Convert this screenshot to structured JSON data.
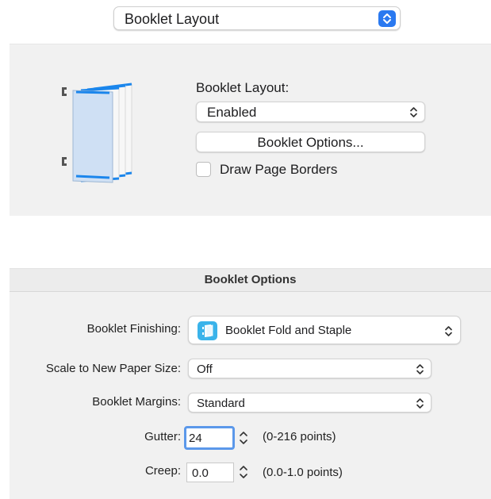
{
  "top_popup": {
    "label": "Booklet Layout"
  },
  "layout_section": {
    "label": "Booklet Layout:",
    "mode_value": "Enabled",
    "options_button": "Booklet Options...",
    "draw_borders_label": "Draw Page Borders",
    "draw_borders_checked": false
  },
  "options_panel": {
    "title": "Booklet Options",
    "finishing": {
      "label": "Booklet Finishing:",
      "value": "Booklet Fold and Staple",
      "icon": "booklet-staple-icon"
    },
    "scale": {
      "label": "Scale to New Paper Size:",
      "value": "Off"
    },
    "margins": {
      "label": "Booklet Margins:",
      "value": "Standard"
    },
    "gutter": {
      "label": "Gutter:",
      "value": "24",
      "range": "(0-216 points)"
    },
    "creep": {
      "label": "Creep:",
      "value": "0.0",
      "range": "(0.0-1.0 points)"
    }
  },
  "colors": {
    "accent": "#2a79f0",
    "focus_ring": "#5b98ea",
    "panel_bg": "#f1f1f1",
    "page_blue": "#cfe0f4",
    "page_edge": "#1b86ec"
  }
}
